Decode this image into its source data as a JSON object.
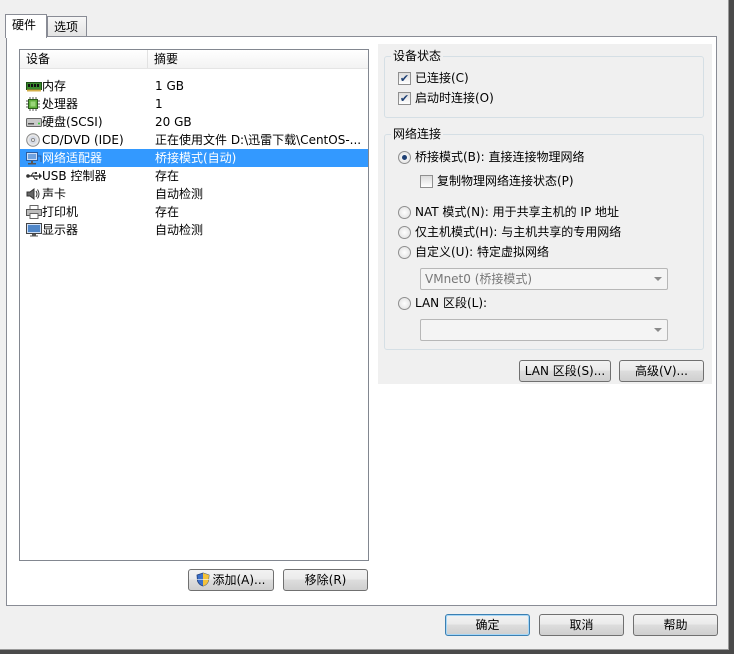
{
  "tabs": [
    {
      "label": "硬件"
    },
    {
      "label": "选项"
    }
  ],
  "device_list": {
    "columns": {
      "device": "设备",
      "summary": "摘要"
    },
    "rows": [
      {
        "name": "内存",
        "summary": "1 GB",
        "icon": "memory-icon"
      },
      {
        "name": "处理器",
        "summary": "1",
        "icon": "processor-icon"
      },
      {
        "name": "硬盘(SCSI)",
        "summary": "20 GB",
        "icon": "hard-disk-icon"
      },
      {
        "name": "CD/DVD (IDE)",
        "summary": "正在使用文件 D:\\迅雷下载\\CentOS-...",
        "icon": "cd-dvd-icon"
      },
      {
        "name": "网络适配器",
        "summary": "桥接模式(自动)",
        "icon": "network-adapter-icon"
      },
      {
        "name": "USB 控制器",
        "summary": "存在",
        "icon": "usb-icon"
      },
      {
        "name": "声卡",
        "summary": "自动检测",
        "icon": "sound-card-icon"
      },
      {
        "name": "打印机",
        "summary": "存在",
        "icon": "printer-icon"
      },
      {
        "name": "显示器",
        "summary": "自动检测",
        "icon": "display-icon"
      }
    ],
    "selected_index": 4
  },
  "list_buttons": {
    "add": "添加(A)...",
    "remove": "移除(R)"
  },
  "device_status": {
    "title": "设备状态",
    "connected": {
      "label": "已连接(C)",
      "checked": true
    },
    "connect_at_power_on": {
      "label": "启动时连接(O)",
      "checked": true
    }
  },
  "network": {
    "title": "网络连接",
    "bridged": {
      "label": "桥接模式(B): 直接连接物理网络",
      "selected": true
    },
    "replicate": {
      "label": "复制物理网络连接状态(P)",
      "checked": false
    },
    "nat": {
      "label": "NAT 模式(N): 用于共享主机的 IP 地址",
      "selected": false
    },
    "host_only": {
      "label": "仅主机模式(H): 与主机共享的专用网络",
      "selected": false
    },
    "custom": {
      "label": "自定义(U): 特定虚拟网络",
      "selected": false
    },
    "custom_select_value": "VMnet0 (桥接模式)",
    "lan_segment": {
      "label": "LAN 区段(L):",
      "selected": false
    },
    "lan_select_value": ""
  },
  "panel_buttons": {
    "lan_segments": "LAN 区段(S)...",
    "advanced": "高级(V)..."
  },
  "dialog_buttons": {
    "ok": "确定",
    "cancel": "取消",
    "help": "帮助"
  },
  "colors": {
    "selection": "#3399ff",
    "panel_bg": "#f0f0f0"
  }
}
